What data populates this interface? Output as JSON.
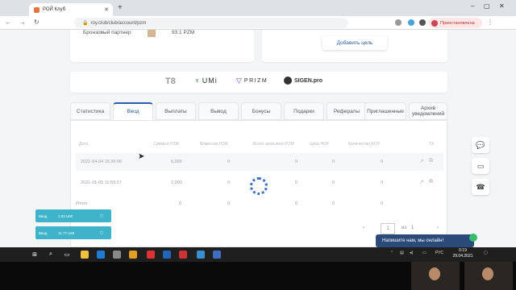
{
  "browser": {
    "tab_title": "РОЙ Клуб",
    "url": "roy.club/club/account/pzm",
    "profile_label": "Приостановлена"
  },
  "partner": {
    "label": "Бронзовый партнер",
    "value": "93.1 PZM"
  },
  "goal_button": "Добавить цель",
  "partners": [
    {
      "name": "T8",
      "text": ""
    },
    {
      "name": "UMI",
      "text": "UMi"
    },
    {
      "name": "PRIZM",
      "text": "PRIZM"
    },
    {
      "name": "SIGEN",
      "text": "SIGEN.pro"
    }
  ],
  "tabs": [
    {
      "label": "Статистика"
    },
    {
      "label": "Ввод",
      "active": true
    },
    {
      "label": "Выплаты"
    },
    {
      "label": "Вывод"
    },
    {
      "label": "Бонусы"
    },
    {
      "label": "Подарки"
    },
    {
      "label": "Рефералы"
    },
    {
      "label": "Приглашенные"
    },
    {
      "label": "Архив уведомлений"
    }
  ],
  "table": {
    "headers": [
      "Дата",
      "Сумма в PZM",
      "Комиссия PZM",
      "Всего зачислено PZM",
      "Цена ROY",
      "Количество ROY",
      "TX"
    ],
    "rows": [
      {
        "date": "2021-04-04 16:36:06",
        "sum": "6,000",
        "fee": "0",
        "total": "0",
        "price": "0",
        "qty": "0"
      },
      {
        "date": "2021-01-05 11:59:27",
        "sum": "2,000",
        "fee": "0",
        "total": "0",
        "price": "0",
        "qty": "0"
      }
    ],
    "totals": {
      "label": "Итого",
      "sum": "0",
      "fee": "0",
      "total": "0",
      "price": "0",
      "qty": "0"
    }
  },
  "pagination": {
    "current": "1",
    "of_label": "из",
    "total": "1"
  },
  "notifications": [
    {
      "title": "Ввод",
      "amount": "1.93 UMI"
    },
    {
      "title": "Ввод",
      "amount": "11.77 UMI"
    }
  ],
  "chat": {
    "text": "Напишите нам, мы онлайн!"
  },
  "taskbar": {
    "lang": "РУС",
    "time": "0:19",
    "date": "29.04.2021"
  },
  "colors": {
    "accent": "#2b5ea8",
    "notification": "#3fb3c9",
    "chat": "#2b4a7a"
  }
}
